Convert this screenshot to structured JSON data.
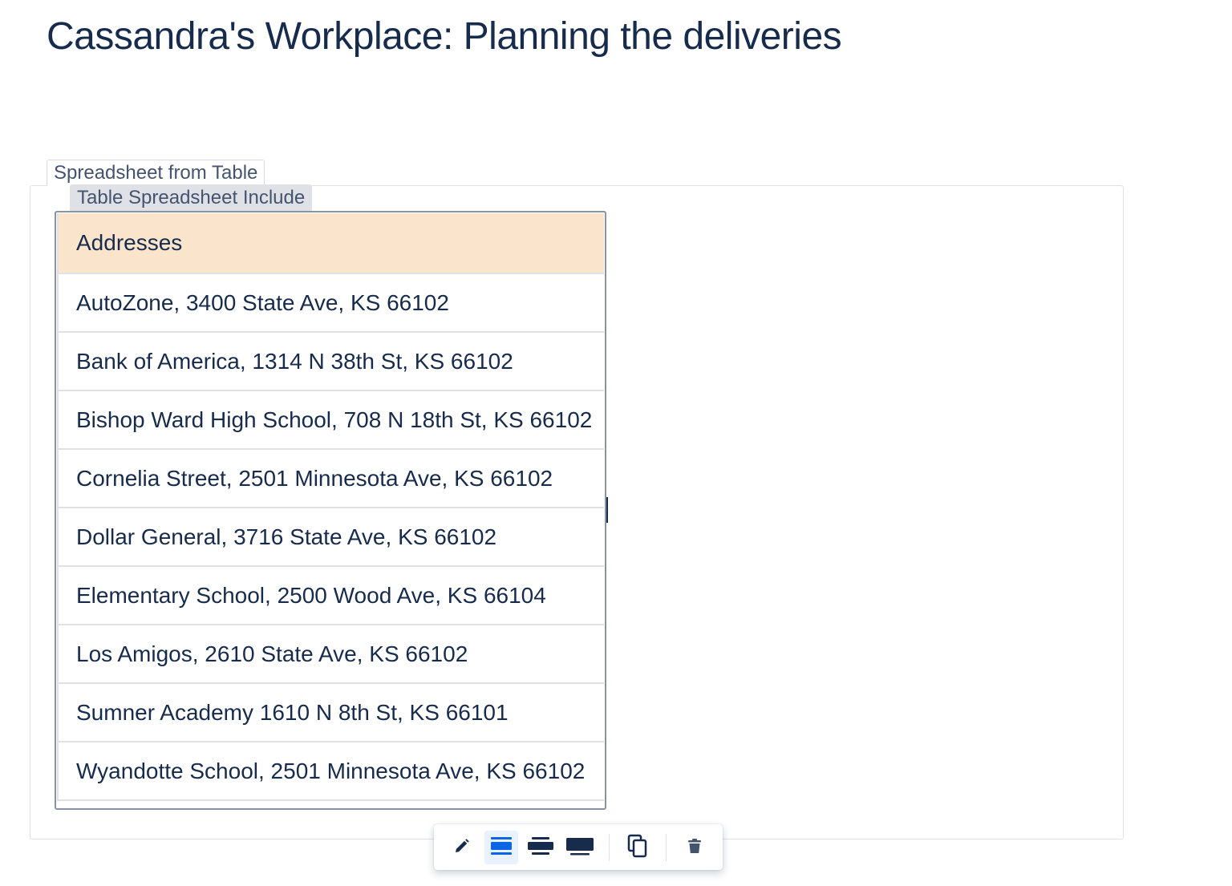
{
  "page": {
    "title": "Cassandra's Workplace: Planning the deliveries"
  },
  "macro": {
    "outer_label": "Spreadsheet from Table",
    "inner_label": "Table Spreadsheet Include"
  },
  "table": {
    "header": "Addresses",
    "rows": [
      "AutoZone, 3400 State Ave, KS 66102",
      "Bank of America, 1314 N 38th St, KS 66102",
      "Bishop Ward High School, 708 N 18th St, KS 66102",
      "Cornelia Street, 2501 Minnesota Ave, KS 66102",
      "Dollar General, 3716 State Ave, KS 66102",
      "Elementary School, 2500 Wood Ave, KS 66104",
      "Los Amigos, 2610 State Ave, KS 66102",
      "Sumner Academy 1610 N 8th St, KS 66101",
      "Wyandotte School, 2501 Minnesota Ave, KS 66102"
    ]
  },
  "toolbar": {
    "buttons": [
      {
        "icon": "pencil-icon",
        "active": false
      },
      {
        "icon": "layout-center-icon",
        "active": true
      },
      {
        "icon": "layout-wide-icon",
        "active": false
      },
      {
        "icon": "layout-full-width-icon",
        "active": false
      },
      {
        "icon": "copy-icon",
        "active": false
      },
      {
        "icon": "trash-icon",
        "active": false
      }
    ]
  },
  "colors": {
    "header_bg": "#fae4cc",
    "text": "#172b4d",
    "active_icon": "#0c66e4",
    "active_bg": "#e9f2ff"
  }
}
